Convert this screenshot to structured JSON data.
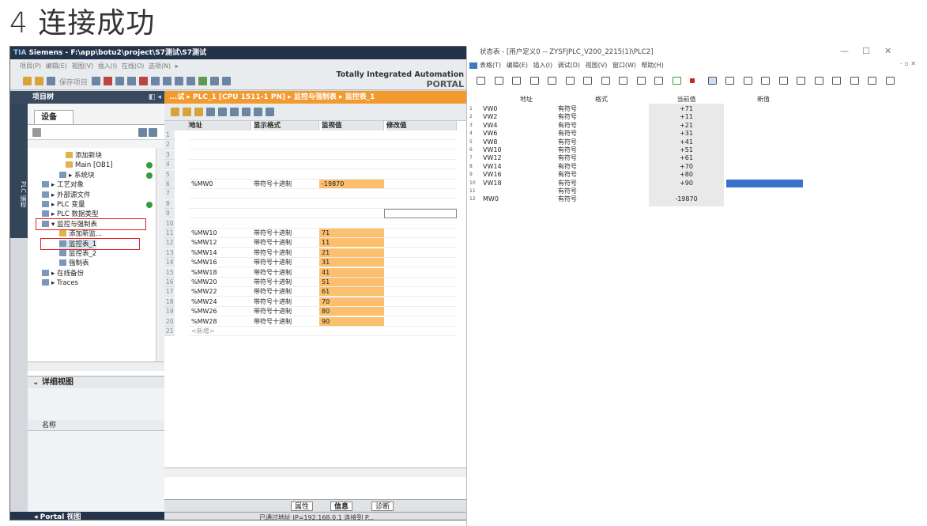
{
  "heading": "4   连接成功",
  "tia": {
    "title": "Siemens  -  F:\\app\\botu2\\project\\S7测试\\S7测试",
    "menu": "项目(P)  编辑(E)  视图(V)  插入(I)  在线(O)  选项(N)  ▸",
    "toolbar_save": "保存项目",
    "brand_line1": "Totally Integrated Automation",
    "brand_line2": "PORTAL",
    "project_tree": {
      "header": "项目树",
      "vertical_tab": "PLC 编程",
      "devices_tab": "设备",
      "items": [
        {
          "label": "添加新块",
          "indent": 70,
          "icon": "add-block-icon"
        },
        {
          "label": "Main [OB1]",
          "indent": 70,
          "icon": "main-ob-icon",
          "status": "ok"
        },
        {
          "label": "▸ 系统块",
          "indent": 62,
          "icon": "system-block-icon",
          "status": "ok"
        },
        {
          "label": "▸ 工艺对象",
          "indent": 40,
          "icon": "tech-object-icon"
        },
        {
          "label": "▸ 外部源文件",
          "indent": 40,
          "icon": "external-source-icon"
        },
        {
          "label": "▸ PLC 变量",
          "indent": 40,
          "icon": "plc-tag-icon",
          "status": "ok"
        },
        {
          "label": "▸ PLC 数据类型",
          "indent": 40,
          "icon": "plc-datatype-icon"
        },
        {
          "label": "▾ 监控与强制表",
          "indent": 40,
          "icon": "watch-table-folder-icon"
        },
        {
          "label": "添加新监...",
          "indent": 62,
          "icon": "add-watch-icon"
        },
        {
          "label": "监控表_1",
          "indent": 62,
          "icon": "watch-table-icon"
        },
        {
          "label": "监控表_2",
          "indent": 62,
          "icon": "watch-table-icon"
        },
        {
          "label": "强制表",
          "indent": 62,
          "icon": "force-table-icon"
        },
        {
          "label": "▸ 在线备份",
          "indent": 40,
          "icon": "online-backup-icon"
        },
        {
          "label": "▸ Traces",
          "indent": 40,
          "icon": "traces-icon"
        }
      ],
      "detail_header": "详细视图",
      "name_column": "名称",
      "portal_view": "◂ Portal 视图"
    },
    "editor": {
      "title": "...试 ▸ PLC_1 [CPU 1511-1 PN] ▸ 监控与强制表 ▸ 监控表_1",
      "columns": [
        "地址",
        "显示格式",
        "监视值",
        "修改值"
      ],
      "rows": [
        {
          "n": "1",
          "addr": "",
          "fmt": "",
          "mon": ""
        },
        {
          "n": "2",
          "addr": "",
          "fmt": "",
          "mon": ""
        },
        {
          "n": "3",
          "addr": "",
          "fmt": "",
          "mon": ""
        },
        {
          "n": "4",
          "addr": "",
          "fmt": "",
          "mon": ""
        },
        {
          "n": "5",
          "addr": "",
          "fmt": "",
          "mon": ""
        },
        {
          "n": "6",
          "addr": "%MW0",
          "fmt": "带符号十进制",
          "mon": "-19870"
        },
        {
          "n": "7",
          "addr": "",
          "fmt": "",
          "mon": ""
        },
        {
          "n": "8",
          "addr": "",
          "fmt": "",
          "mon": ""
        },
        {
          "n": "9",
          "addr": "",
          "fmt": "",
          "mon": ""
        },
        {
          "n": "10",
          "addr": "",
          "fmt": "",
          "mon": ""
        },
        {
          "n": "11",
          "addr": "%MW10",
          "fmt": "带符号十进制",
          "mon": "71"
        },
        {
          "n": "12",
          "addr": "%MW12",
          "fmt": "带符号十进制",
          "mon": "11"
        },
        {
          "n": "13",
          "addr": "%MW14",
          "fmt": "带符号十进制",
          "mon": "21"
        },
        {
          "n": "14",
          "addr": "%MW16",
          "fmt": "带符号十进制",
          "mon": "31"
        },
        {
          "n": "15",
          "addr": "%MW18",
          "fmt": "带符号十进制",
          "mon": "41"
        },
        {
          "n": "16",
          "addr": "%MW20",
          "fmt": "带符号十进制",
          "mon": "51"
        },
        {
          "n": "17",
          "addr": "%MW22",
          "fmt": "带符号十进制",
          "mon": "61"
        },
        {
          "n": "18",
          "addr": "%MW24",
          "fmt": "带符号十进制",
          "mon": "70"
        },
        {
          "n": "19",
          "addr": "%MW26",
          "fmt": "带符号十进制",
          "mon": "80"
        },
        {
          "n": "20",
          "addr": "%MW28",
          "fmt": "带符号十进制",
          "mon": "90"
        },
        {
          "n": "21",
          "addr": "<新增>",
          "fmt": "",
          "mon": ""
        }
      ],
      "status_tabs": [
        "属性",
        "信息",
        "诊断"
      ],
      "taskbar_text": "已通过地址 IP=192.168.0.1 连接到 P..."
    }
  },
  "micro": {
    "title": "状态表 - [用户定义0 -- ZYSFJPLC_V200_2215(1)\\PLC2]",
    "menu": "表格(T)  编辑(E)  插入(I)  调试(D)  视图(V)  窗口(W)  帮助(H)",
    "columns": [
      "地址",
      "格式",
      "当前值",
      "新值"
    ],
    "rows": [
      {
        "n": "1",
        "addr": "VW0",
        "fmt": "有符号",
        "cur": "+71"
      },
      {
        "n": "2",
        "addr": "VW2",
        "fmt": "有符号",
        "cur": "+11"
      },
      {
        "n": "3",
        "addr": "VW4",
        "fmt": "有符号",
        "cur": "+21"
      },
      {
        "n": "4",
        "addr": "VW6",
        "fmt": "有符号",
        "cur": "+31"
      },
      {
        "n": "5",
        "addr": "VW8",
        "fmt": "有符号",
        "cur": "+41"
      },
      {
        "n": "6",
        "addr": "VW10",
        "fmt": "有符号",
        "cur": "+51"
      },
      {
        "n": "7",
        "addr": "VW12",
        "fmt": "有符号",
        "cur": "+61"
      },
      {
        "n": "8",
        "addr": "VW14",
        "fmt": "有符号",
        "cur": "+70"
      },
      {
        "n": "9",
        "addr": "VW16",
        "fmt": "有符号",
        "cur": "+80"
      },
      {
        "n": "10",
        "addr": "VW18",
        "fmt": "有符号",
        "cur": "+90"
      },
      {
        "n": "11",
        "addr": "",
        "fmt": "有符号",
        "cur": ""
      },
      {
        "n": "12",
        "addr": "MW0",
        "fmt": "有符号",
        "cur": "-19870"
      }
    ]
  },
  "colors": {
    "monitor_orange": "#fbbf6e",
    "editor_title": "#f39a2f",
    "selection_blue": "#3a73c9",
    "highlight_red": "#e02020"
  }
}
